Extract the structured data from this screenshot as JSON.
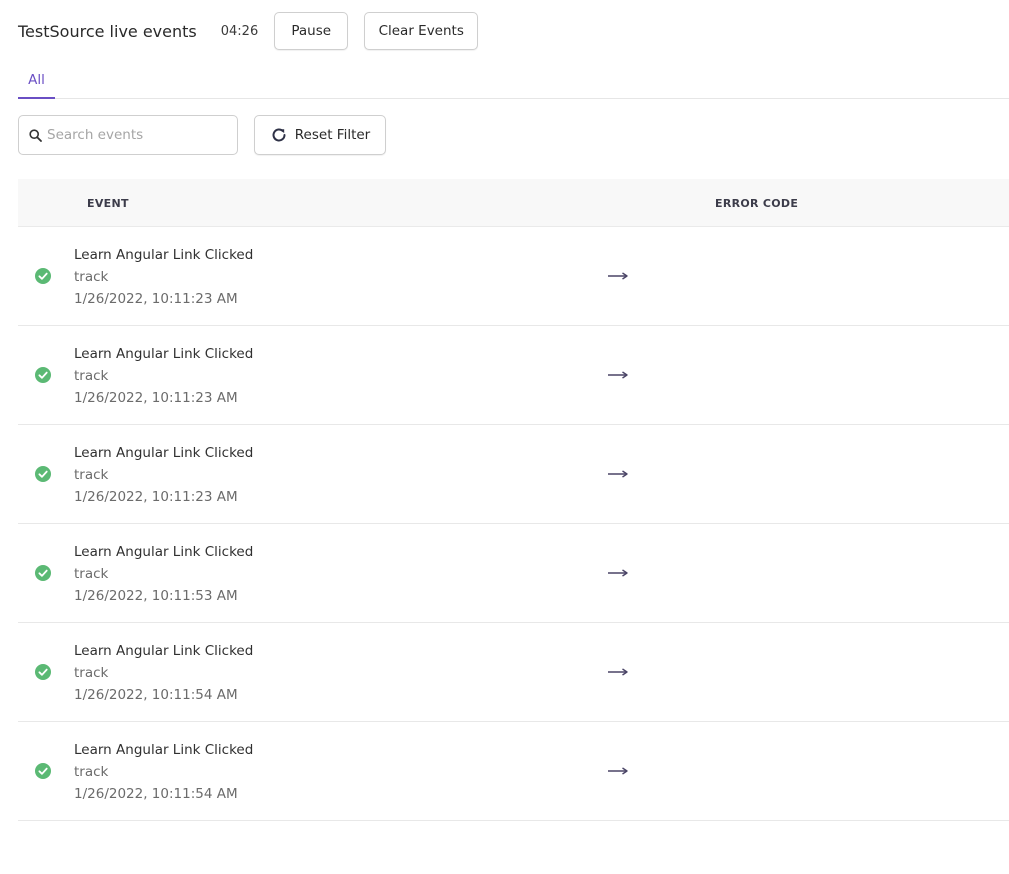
{
  "header": {
    "title": "TestSource live events",
    "timer": "04:26",
    "pause_label": "Pause",
    "clear_label": "Clear Events"
  },
  "tabs": [
    {
      "label": "All",
      "active": true
    }
  ],
  "toolbar": {
    "search_placeholder": "Search events",
    "search_value": "",
    "reset_label": "Reset Filter"
  },
  "table": {
    "columns": [
      "EVENT",
      "ERROR CODE"
    ],
    "rows": [
      {
        "status": "success",
        "name": "Learn Angular Link Clicked",
        "type": "track",
        "timestamp": "1/26/2022, 10:11:23 AM"
      },
      {
        "status": "success",
        "name": "Learn Angular Link Clicked",
        "type": "track",
        "timestamp": "1/26/2022, 10:11:23 AM"
      },
      {
        "status": "success",
        "name": "Learn Angular Link Clicked",
        "type": "track",
        "timestamp": "1/26/2022, 10:11:23 AM"
      },
      {
        "status": "success",
        "name": "Learn Angular Link Clicked",
        "type": "track",
        "timestamp": "1/26/2022, 10:11:53 AM"
      },
      {
        "status": "success",
        "name": "Learn Angular Link Clicked",
        "type": "track",
        "timestamp": "1/26/2022, 10:11:54 AM"
      },
      {
        "status": "success",
        "name": "Learn Angular Link Clicked",
        "type": "track",
        "timestamp": "1/26/2022, 10:11:54 AM"
      }
    ]
  },
  "icons": {
    "search": "search-icon",
    "reset": "refresh-icon",
    "status": "check-circle-icon",
    "row_action": "arrow-right-icon"
  },
  "colors": {
    "accent": "#6a4fc4",
    "success": "#5bb974",
    "arrow": "#4a4466"
  }
}
